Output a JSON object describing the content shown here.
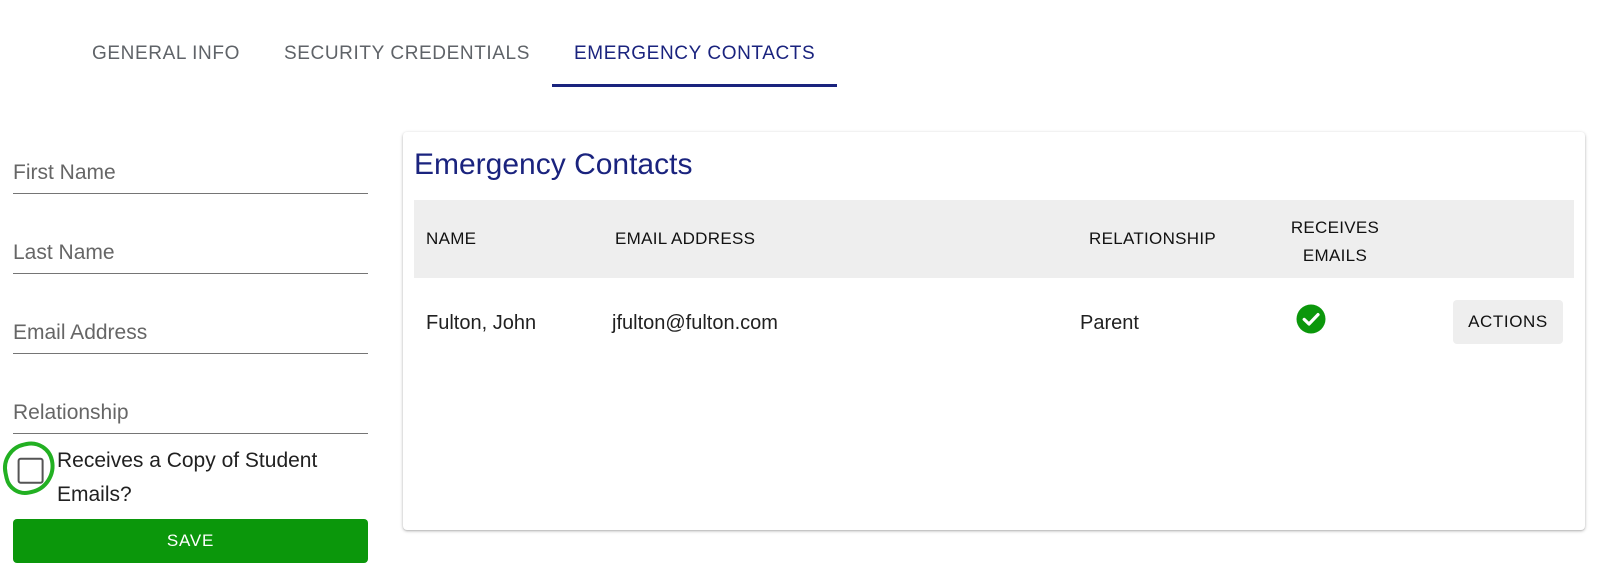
{
  "tabs": [
    {
      "label": "GENERAL INFO",
      "active": false
    },
    {
      "label": "SECURITY CREDENTIALS",
      "active": false
    },
    {
      "label": "EMERGENCY CONTACTS",
      "active": true
    }
  ],
  "form": {
    "first_name": {
      "placeholder": "First Name",
      "value": ""
    },
    "last_name": {
      "placeholder": "Last Name",
      "value": ""
    },
    "email": {
      "placeholder": "Email Address",
      "value": ""
    },
    "relationship": {
      "placeholder": "Relationship",
      "value": ""
    },
    "receives_copy": {
      "label": "Receives a Copy of Student Emails?",
      "checked": false
    },
    "save_label": "SAVE"
  },
  "contacts": {
    "title": "Emergency Contacts",
    "columns": {
      "name": "NAME",
      "email": "EMAIL ADDRESS",
      "relationship": "RELATIONSHIP",
      "receives_emails_line1": "RECEIVES",
      "receives_emails_line2": "EMAILS"
    },
    "rows": [
      {
        "name": "Fulton, John",
        "email": "jfulton@fulton.com",
        "relationship": "Parent",
        "receives_emails": true,
        "actions_label": "ACTIONS"
      }
    ]
  },
  "colors": {
    "accent": "#1a237e",
    "save": "#0b970b",
    "check": "#0b970b",
    "annotation": "#22b022"
  },
  "icons": {
    "receives_emails": "check-circle-icon"
  }
}
